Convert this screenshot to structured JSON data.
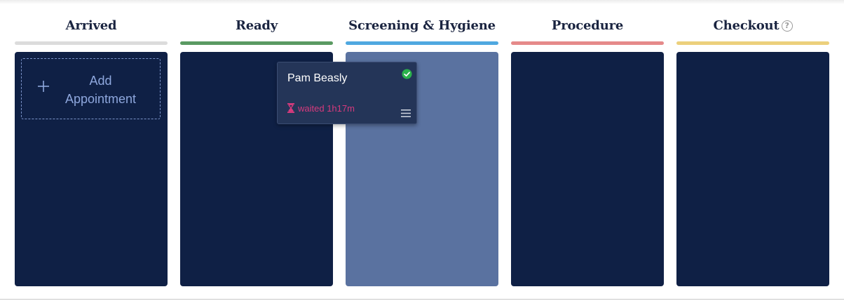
{
  "columns": [
    {
      "title": "Arrived",
      "bar_color": "#dcdcdc",
      "highlight": false
    },
    {
      "title": "Ready",
      "bar_color": "#5a9a62",
      "highlight": false
    },
    {
      "title": "Screening & Hygiene",
      "bar_color": "#4fa8e0",
      "highlight": true
    },
    {
      "title": "Procedure",
      "bar_color": "#e58a8a",
      "highlight": false
    },
    {
      "title": "Checkout",
      "bar_color": "#ecd07c",
      "highlight": false,
      "help_icon": "help-circle-icon"
    }
  ],
  "add_appointment": {
    "label": "Add Appointment",
    "icon": "plus-icon"
  },
  "card": {
    "name": "Pam Beasly",
    "status_icon": "check-circle-icon",
    "status_color": "#2bb24c",
    "wait_text": "waited 1h17m",
    "wait_color": "#d63a7d",
    "wait_icon": "hourglass-icon",
    "menu_icon": "menu-icon"
  },
  "colors": {
    "column_bg": "#0f2045",
    "column_highlight_bg": "#5a72a0",
    "card_bg": "#243558"
  }
}
